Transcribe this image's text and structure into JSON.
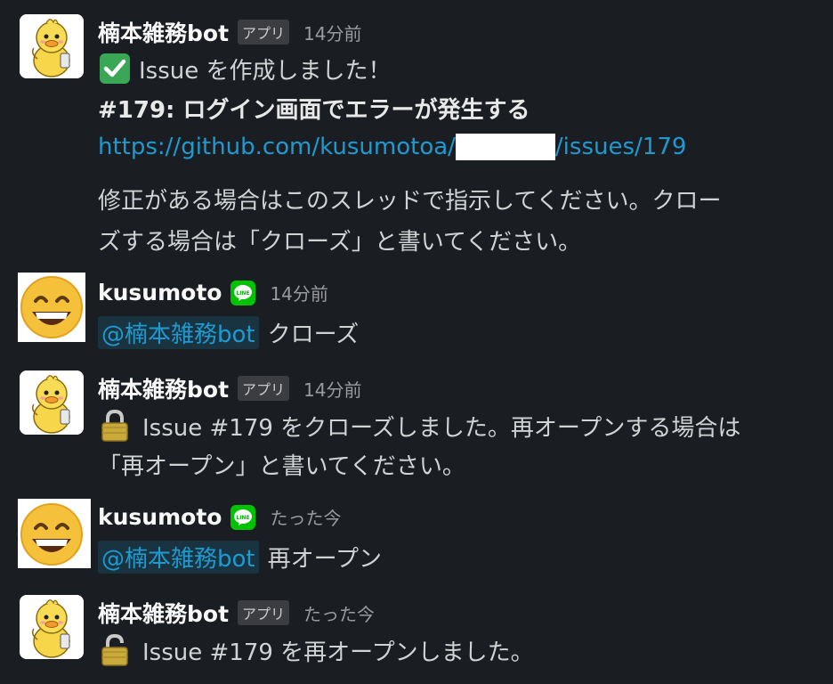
{
  "messages": [
    {
      "author": "楠本雑務bot",
      "badge": "アプリ",
      "time": "14分前",
      "line1": "Issue を作成しました！",
      "issue_title": "#179: ログイン画面でエラーが発生する",
      "link_prefix": "https://github.com/kusumotoa/",
      "link_suffix": "/issues/179",
      "line3": "修正がある場合はこのスレッドで指示してください。クロー",
      "line4": "ズする場合は「クローズ」と書いてください。"
    },
    {
      "author": "kusumoto",
      "time": "14分前",
      "mention": "@楠本雑務bot",
      "text": "クローズ"
    },
    {
      "author": "楠本雑務bot",
      "badge": "アプリ",
      "time": "14分前",
      "line1": "Issue #179 をクローズしました。再オープンする場合は",
      "line2": "「再オープン」と書いてください。"
    },
    {
      "author": "kusumoto",
      "time": "たった今",
      "mention": "@楠本雑務bot",
      "text": "再オープン"
    },
    {
      "author": "楠本雑務bot",
      "badge": "アプリ",
      "time": "たった今",
      "line1": "Issue #179 を再オープンしました。"
    }
  ],
  "icons": {
    "bot_avatar": "duck-avatar",
    "user_avatar": "grinning-face-emoji",
    "line_badge": "line-icon",
    "check": "check-mark-icon",
    "lock": "lock-icon"
  },
  "colors": {
    "background": "#1a1d21",
    "link": "#1d9bd1",
    "line_green": "#00c300"
  }
}
